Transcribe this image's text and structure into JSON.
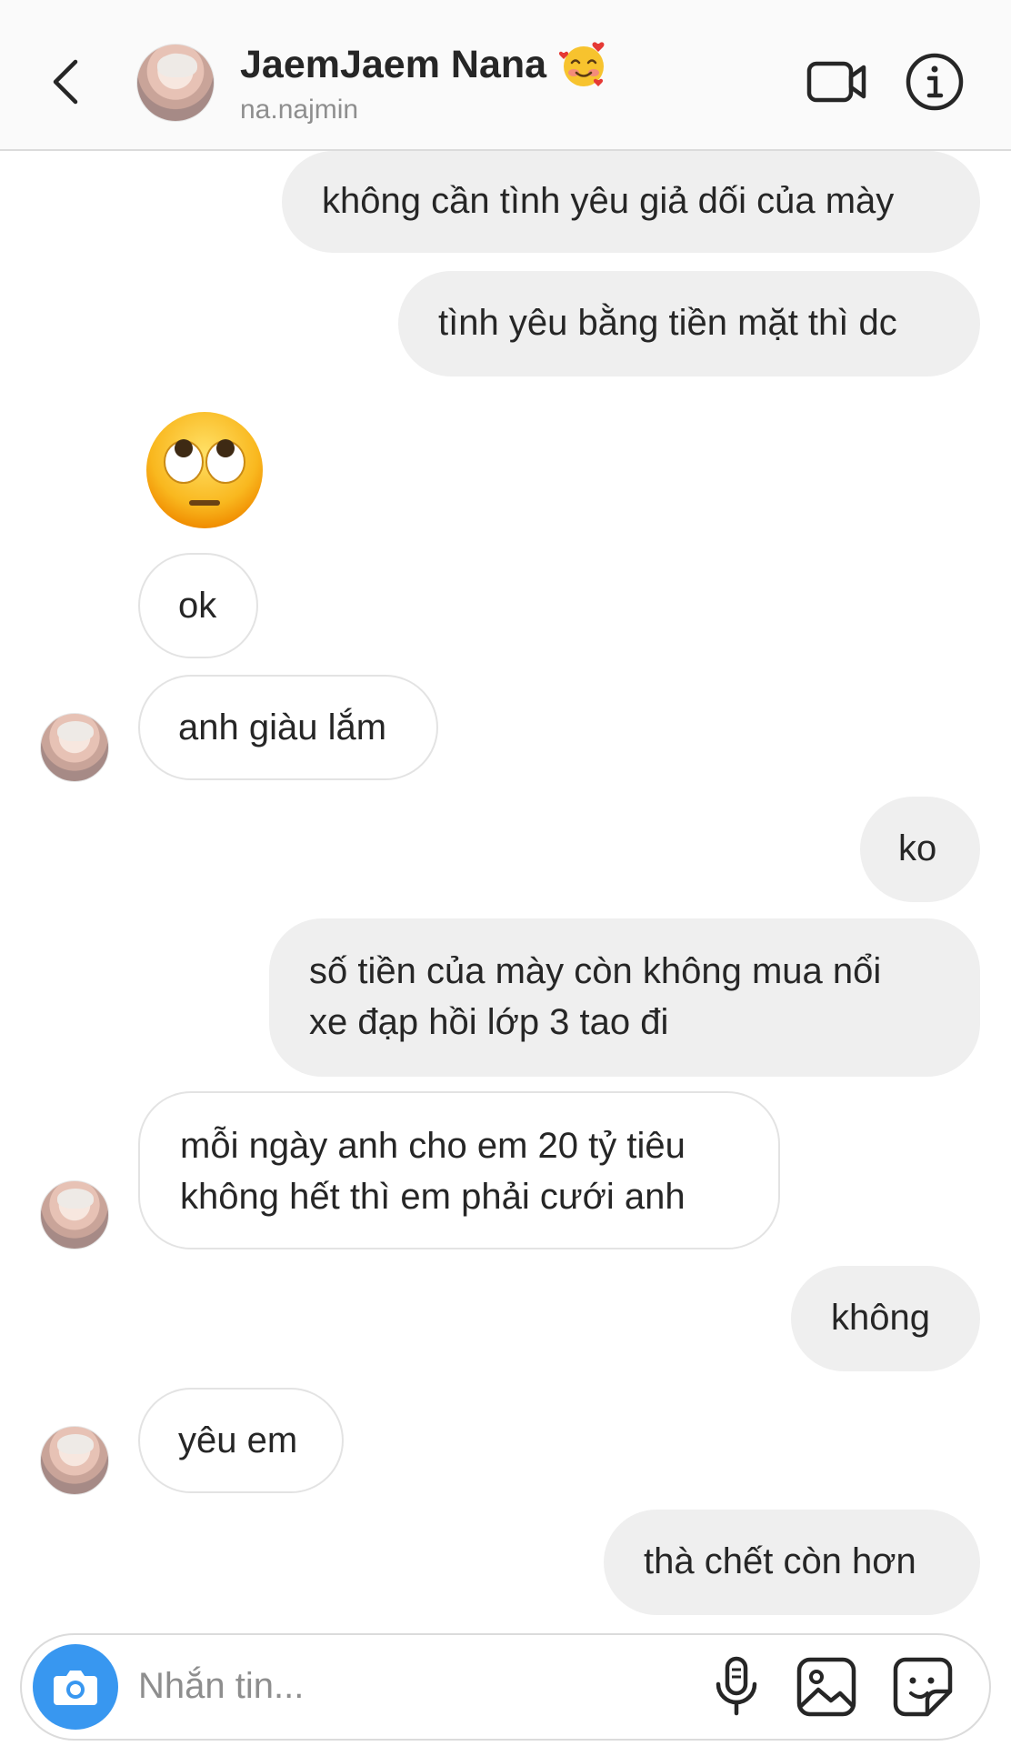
{
  "header": {
    "name": "JaemJaem Nana",
    "username": "na.najmin"
  },
  "messages": [
    {
      "side": "out",
      "text": "không cần tình yêu giả dối của mày"
    },
    {
      "side": "out",
      "text": "tình yêu bằng tiền mặt thì dc"
    },
    {
      "side": "in",
      "type": "emoji",
      "emoji": "face-with-rolling-eyes"
    },
    {
      "side": "in",
      "text": "ok"
    },
    {
      "side": "in",
      "text": "anh giàu lắm"
    },
    {
      "side": "out",
      "text": "ko"
    },
    {
      "side": "out",
      "lines": [
        "số tiền của mày còn không mua nổi",
        "xe đạp hồi lớp 3 tao đi"
      ]
    },
    {
      "side": "in",
      "lines": [
        "mỗi ngày anh cho em 20 tỷ tiêu",
        "không hết thì em phải cưới anh"
      ]
    },
    {
      "side": "out",
      "text": "không"
    },
    {
      "side": "in",
      "text": "yêu em"
    },
    {
      "side": "out",
      "text": "thà chết còn hơn"
    }
  ],
  "composer": {
    "placeholder": "Nhắn tin..."
  },
  "colors": {
    "accent": "#3897f0",
    "outgoing_bubble": "#efefef",
    "incoming_border": "#e3e3e3",
    "secondary_text": "#8e8e8e"
  }
}
